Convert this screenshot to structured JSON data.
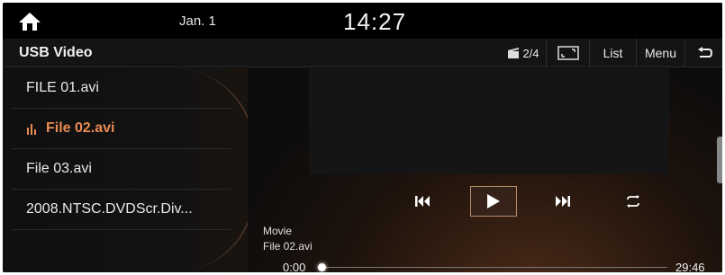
{
  "status_bar": {
    "date": "Jan. 1",
    "time": "14:27"
  },
  "header": {
    "title": "USB Video",
    "camera_angle": "2/4",
    "list_label": "List",
    "menu_label": "Menu"
  },
  "files": [
    {
      "label": "FILE 01.avi",
      "active": false
    },
    {
      "label": "File 02.avi",
      "active": true
    },
    {
      "label": "File 03.avi",
      "active": false
    },
    {
      "label": "2008.NTSC.DVDScr.Div...",
      "active": false
    }
  ],
  "now_playing": {
    "category": "Movie",
    "file": "File 02.avi",
    "current_time": "0:00",
    "total_time": "29:46",
    "progress": 0.0
  },
  "colors": {
    "active": "#ea8a55",
    "background": "#0b0b0b"
  },
  "icons": [
    "home-icon",
    "camera-icon",
    "fullscreen-icon",
    "back-icon",
    "equalizer-icon",
    "previous-icon",
    "play-icon",
    "next-icon",
    "repeat-icon"
  ]
}
